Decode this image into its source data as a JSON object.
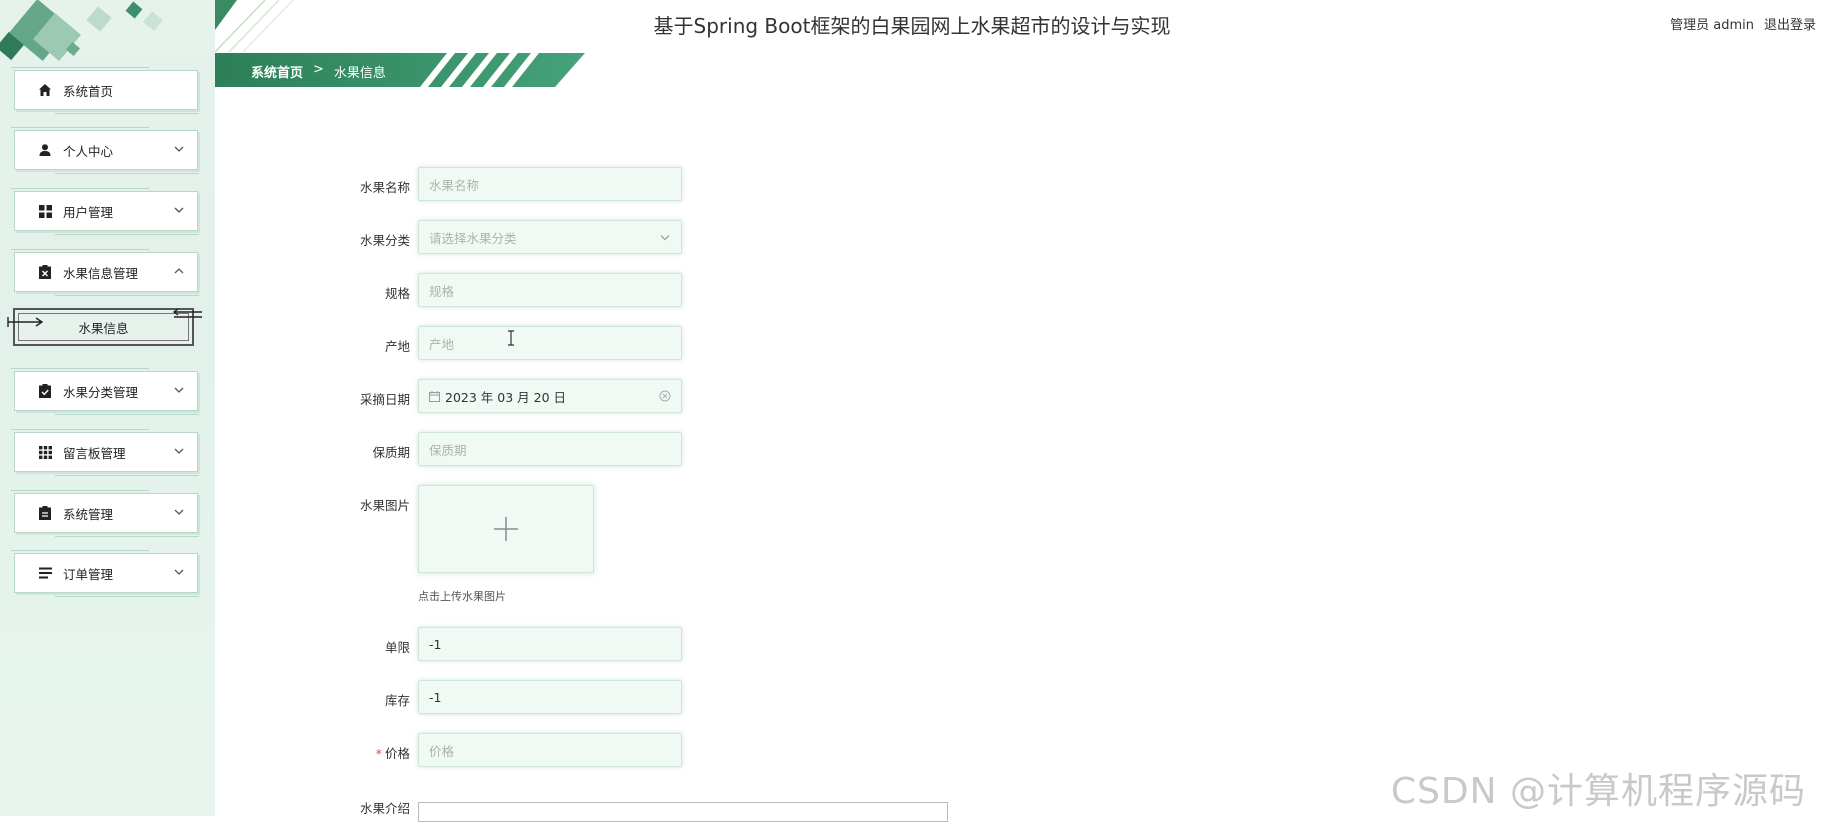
{
  "header": {
    "title": "基于Spring Boot框架的白果园网上水果超市的设计与实现",
    "user_label": "管理员 admin",
    "logout_label": "退出登录"
  },
  "breadcrumb": {
    "home": "系统首页",
    "separator": ">",
    "current": "水果信息"
  },
  "sidebar": {
    "items": [
      {
        "label": "系统首页",
        "icon": "home-icon"
      },
      {
        "label": "个人中心",
        "icon": "user-icon",
        "arrow": "chevron-down"
      },
      {
        "label": "用户管理",
        "icon": "grid-icon",
        "arrow": "chevron-down"
      },
      {
        "label": "水果信息管理",
        "icon": "clipboard-x-icon",
        "arrow": "chevron-up"
      },
      {
        "label": "水果分类管理",
        "icon": "clipboard-check-icon",
        "arrow": "chevron-down"
      },
      {
        "label": "留言板管理",
        "icon": "apps-icon",
        "arrow": "chevron-down"
      },
      {
        "label": "系统管理",
        "icon": "clipboard-icon",
        "arrow": "chevron-down"
      },
      {
        "label": "订单管理",
        "icon": "list-icon",
        "arrow": "chevron-down"
      }
    ],
    "submenu_active": "水果信息"
  },
  "form": {
    "name": {
      "label": "水果名称",
      "placeholder": "水果名称"
    },
    "category": {
      "label": "水果分类",
      "placeholder": "请选择水果分类"
    },
    "spec": {
      "label": "规格",
      "placeholder": "规格"
    },
    "origin": {
      "label": "产地",
      "placeholder": "产地"
    },
    "pick_date": {
      "label": "采摘日期",
      "value": "2023 年 03 月 20 日"
    },
    "shelf_life": {
      "label": "保质期",
      "placeholder": "保质期"
    },
    "image": {
      "label": "水果图片",
      "tip": "点击上传水果图片"
    },
    "limit": {
      "label": "单限",
      "value": "-1"
    },
    "stock": {
      "label": "库存",
      "value": "-1"
    },
    "price": {
      "label": "价格",
      "placeholder": "价格",
      "required_mark": "*"
    },
    "intro": {
      "label": "水果介绍"
    }
  },
  "watermark": "CSDN @计算机程序源码",
  "colors": {
    "brand_green": "#2e8a5f",
    "sidebar_bg": "#e4f2eb",
    "input_bg": "#f1f9f4",
    "required": "#e14b4b"
  }
}
